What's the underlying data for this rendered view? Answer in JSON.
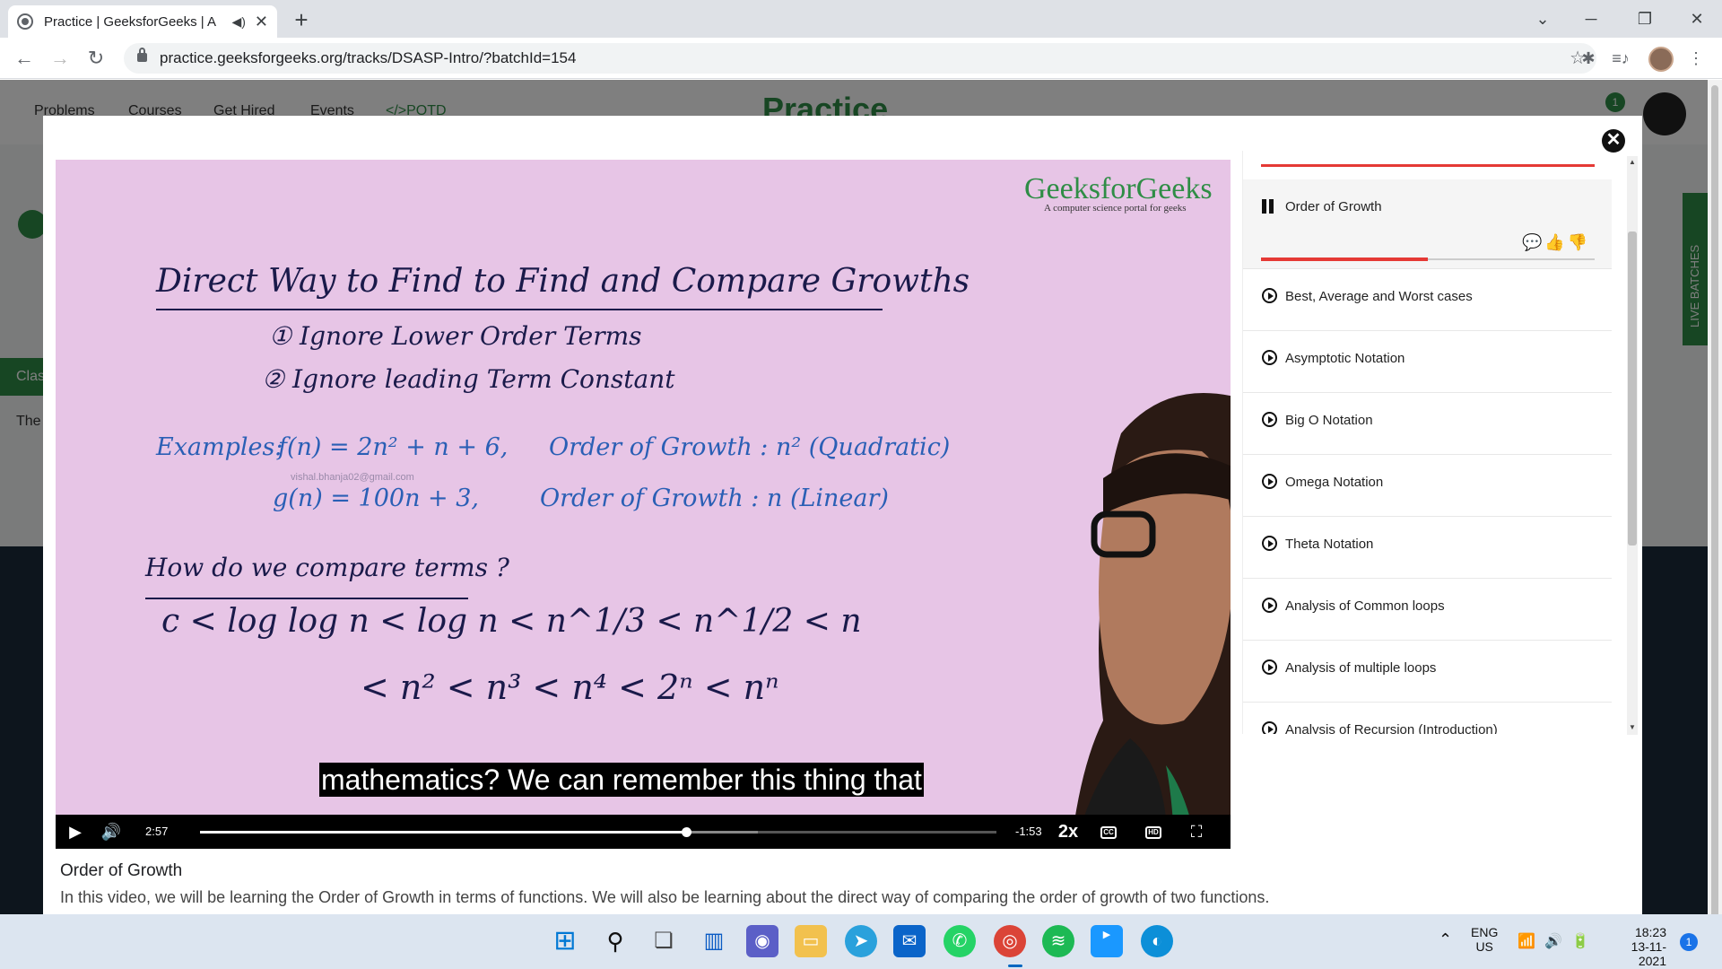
{
  "browser": {
    "tab_title": "Practice | GeeksforGeeks | A",
    "url": "practice.geeksforgeeks.org/tracks/DSASP-Intro/?batchId=154"
  },
  "site": {
    "nav": [
      "Problems",
      "Courses",
      "Get Hired",
      "Events",
      "</>POTD"
    ],
    "logo": "Practice",
    "notif_count": "1",
    "left_tab_1": "Clas",
    "left_tab_2": "The",
    "right_badge": "LIVE BATCHES"
  },
  "video": {
    "brand": "GeeksforGeeks",
    "brand_tagline": "A computer science portal for geeks",
    "board": {
      "heading": "Direct Way to Find to Find and Compare Growths",
      "rule1": "① Ignore Lower Order Terms",
      "rule2": "② Ignore leading Term Constant",
      "examples_label": "Examples:",
      "ex1": "f(n) = 2n² + n + 6,",
      "ex1_growth": "Order of Growth : n² (Quadratic)",
      "ex2": "g(n) = 100n + 3,",
      "ex2_growth": "Order of Growth : n (Linear)",
      "watermark": "vishal.bhanja02@gmail.com",
      "compare_q": "How do we compare terms ?",
      "line1": "c < log log n < log n < n^1/3 < n^1/2 < n",
      "line2": "< n² < n³ < n⁴ < 2ⁿ < nⁿ"
    },
    "caption": "mathematics? We can remember this thing that",
    "current_time": "2:57",
    "remaining_time": "-1:53",
    "speed": "2x",
    "progress": 0.61,
    "buffered": 0.7,
    "title": "Order of Growth",
    "description": "In this video, we will be learning the Order of Growth in terms of functions. We will also be learning about the direct way of comparing the order of growth of two functions."
  },
  "playlist": {
    "active": {
      "label": "Order of Growth",
      "progress": 0.5
    },
    "items": [
      "Best, Average and Worst cases",
      "Asymptotic Notation",
      "Big O Notation",
      "Omega Notation",
      "Theta Notation",
      "Analysis of Common loops",
      "Analysis of multiple loops",
      "Analysis of Recursion (Introduction)"
    ]
  },
  "taskbar": {
    "lang": "ENG",
    "region": "US",
    "time": "18:23",
    "date": "13-11-2021",
    "notif": "1"
  },
  "colors": {
    "accent_red": "#e53935",
    "gfg_green": "#2f8d46",
    "board_pink": "#e7c5e6"
  }
}
